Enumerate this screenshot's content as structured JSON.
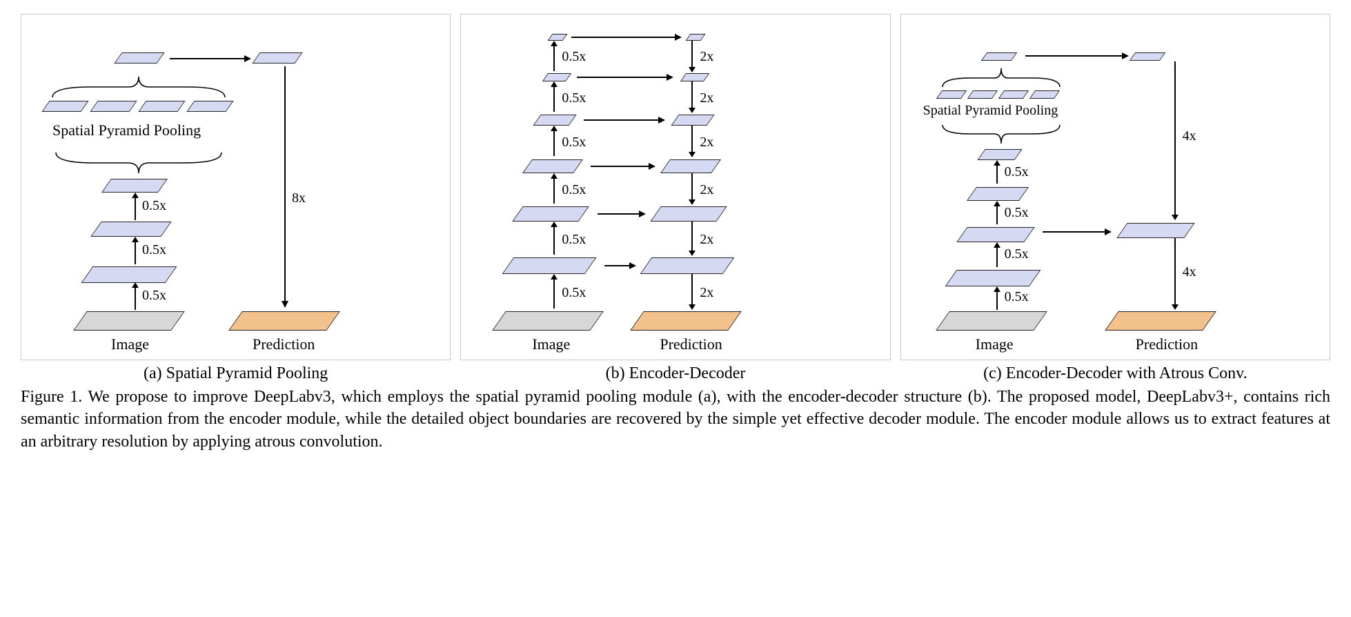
{
  "figure_number": "Figure 1.",
  "caption_body": "We propose to improve DeepLabv3, which employs the spatial pyramid pooling module (a), with the encoder-decoder structure (b). The proposed model, DeepLabv3+, contains rich semantic information from the encoder module, while the detailed object boundaries are recovered by the simple yet effective decoder module. The encoder module allows us to extract features at an arbitrary resolution by applying atrous convolution.",
  "subtitles": {
    "a": "(a) Spatial Pyramid Pooling",
    "b": "(b) Encoder-Decoder",
    "c": "(c) Encoder-Decoder with Atrous Conv."
  },
  "labels": {
    "spp": "Spatial Pyramid Pooling",
    "image": "Image",
    "prediction": "Prediction",
    "x05": "0.5x",
    "x2": "2x",
    "x4": "4x",
    "x8": "8x"
  },
  "colors": {
    "feature": "#d6d9f2",
    "input": "#d7d7d7",
    "prediction": "#f3c28c",
    "spp_rect_1": "#e06a2a",
    "spp_rect_2": "#d83fae",
    "spp_rect_3": "#d83fae",
    "spp_rect_4": "#d8a038"
  },
  "chart_data": {
    "type": "diagram",
    "panels": [
      {
        "id": "a",
        "title": "Spatial Pyramid Pooling",
        "encoder_downsample_steps": [
          "0.5x",
          "0.5x",
          "0.5x"
        ],
        "spp_branches": 4,
        "spp_label": "Spatial Pyramid Pooling",
        "top_merge_arrow": true,
        "prediction_upsample": "8x",
        "bottom_labels": [
          "Image",
          "Prediction"
        ]
      },
      {
        "id": "b",
        "title": "Encoder-Decoder",
        "encoder_downsample_steps": [
          "0.5x",
          "0.5x",
          "0.5x",
          "0.5x",
          "0.5x"
        ],
        "decoder_upsample_steps": [
          "2x",
          "2x",
          "2x",
          "2x",
          "2x"
        ],
        "skip_connections": 6,
        "bottom_labels": [
          "Image",
          "Prediction"
        ]
      },
      {
        "id": "c",
        "title": "Encoder-Decoder with Atrous Conv.",
        "encoder_downsample_steps": [
          "0.5x",
          "0.5x",
          "0.5x",
          "0.5x"
        ],
        "spp_branches": 4,
        "spp_label": "Spatial Pyramid Pooling",
        "top_merge_arrow": true,
        "decoder_upsample_steps": [
          "4x",
          "4x"
        ],
        "decoder_skip_from_encoder_level": 2,
        "bottom_labels": [
          "Image",
          "Prediction"
        ]
      }
    ]
  }
}
